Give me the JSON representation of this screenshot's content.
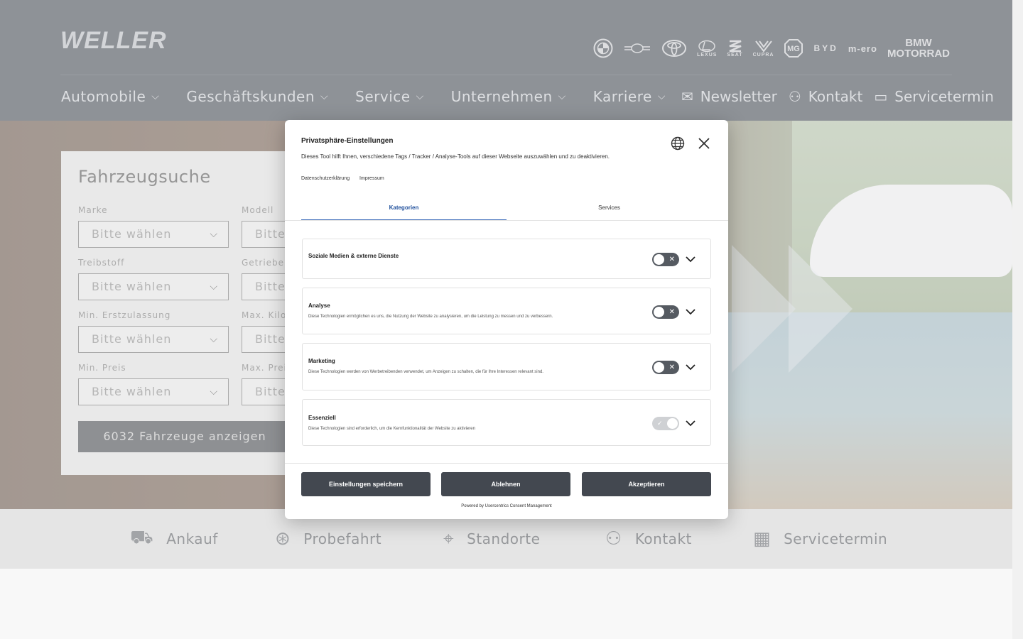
{
  "header": {
    "logo": "WELLER",
    "brands": [
      {
        "name": "bmw-logo",
        "label": ""
      },
      {
        "name": "mini-logo",
        "label": ""
      },
      {
        "name": "toyota-logo",
        "label": ""
      },
      {
        "name": "lexus-logo",
        "label": "LEXUS"
      },
      {
        "name": "seat-logo",
        "label": "SEAT"
      },
      {
        "name": "cupra-logo",
        "label": "CUPRA"
      },
      {
        "name": "mg-logo",
        "label": "MG"
      },
      {
        "name": "byd-logo",
        "label": "BYD"
      },
      {
        "name": "m-ero-logo",
        "label": "m-ero"
      }
    ],
    "motorrad_line1": "BMW",
    "motorrad_line2": "MOTORRAD",
    "nav": {
      "automobile": "Automobile",
      "geschaeftskunden": "Geschäftskunden",
      "service": "Service",
      "unternehmen": "Unternehmen",
      "karriere": "Karriere",
      "newsletter": "Newsletter",
      "kontakt": "Kontakt",
      "servicetermin": "Servicetermin"
    }
  },
  "search": {
    "title": "Fahrzeugsuche",
    "fields": [
      {
        "label": "Marke",
        "value": "Bitte wählen"
      },
      {
        "label": "Modell",
        "value": "Bitte wählen"
      },
      {
        "label": "Treibstoff",
        "value": "Bitte wählen"
      },
      {
        "label": "Getriebe",
        "value": "Bitte wählen"
      },
      {
        "label": "Min. Erstzulassung",
        "value": "Bitte wählen"
      },
      {
        "label": "Max. Kilometer",
        "value": "Bitte wählen"
      },
      {
        "label": "Min. Preis",
        "value": "Bitte wählen"
      },
      {
        "label": "Max. Preis",
        "value": "Bitte wählen"
      }
    ],
    "button": "6032 Fahrzeuge anzeigen"
  },
  "quicklinks": {
    "ankauf": "Ankauf",
    "probefahrt": "Probefahrt",
    "standorte": "Standorte",
    "kontakt": "Kontakt",
    "servicetermin": "Servicetermin"
  },
  "modal": {
    "title": "Privatsphäre-Einstellungen",
    "description": "Dieses Tool hilft Ihnen, verschiedene Tags / Tracker / Analyse-Tools auf dieser Webseite auszuwählen und zu deaktivieren.",
    "link_privacy": "Datenschutzerklärung",
    "link_imprint": "Impressum",
    "tab_categories": "Kategorien",
    "tab_services": "Services",
    "categories": [
      {
        "name": "Soziale Medien & externe Dienste",
        "desc": "",
        "enabled": false
      },
      {
        "name": "Analyse",
        "desc": "Diese Technologien ermöglichen es uns, die Nutzung der Website zu analysieren, um die Leistung zu messen und zu verbessern.",
        "enabled": false
      },
      {
        "name": "Marketing",
        "desc": "Diese Technologien werden von Werbetreibenden verwendet, um Anzeigen zu schalten, die für Ihre Interessen relevant sind.",
        "enabled": false
      },
      {
        "name": "Essenziell",
        "desc": "Diese Technologien sind erforderlich, um die Kernfunktionalität der Website zu aktivieren",
        "enabled": true
      }
    ],
    "btn_save": "Einstellungen speichern",
    "btn_deny": "Ablehnen",
    "btn_accept": "Akzeptieren",
    "powered": "Powered by Usercentrics Consent Management"
  },
  "colors": {
    "header_bg": "#4a4f58",
    "accent_tab": "#3566b8",
    "button_bg": "#434850"
  }
}
